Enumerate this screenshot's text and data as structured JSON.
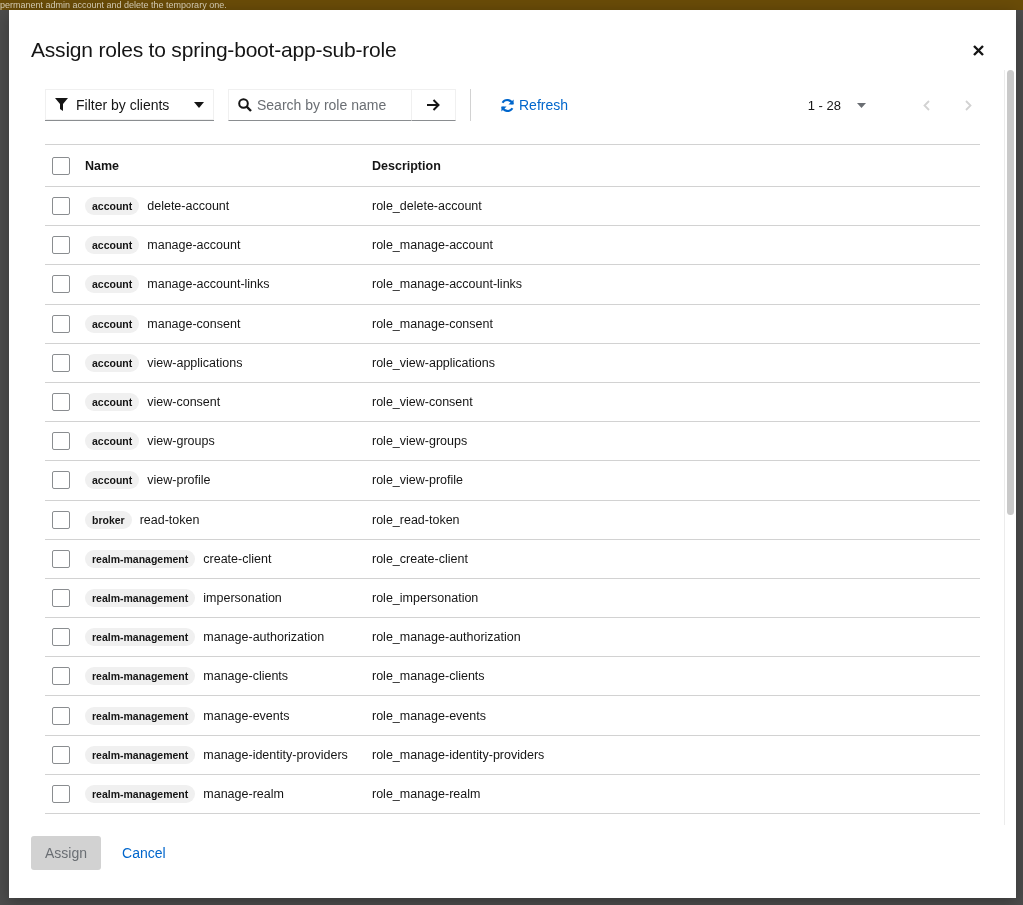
{
  "banner": {
    "text": "permanent admin account and delete the temporary one."
  },
  "modal": {
    "title": "Assign roles to spring-boot-app-sub-role"
  },
  "toolbar": {
    "filter": {
      "label": "Filter by clients"
    },
    "search": {
      "placeholder": "Search by role name"
    },
    "refresh": {
      "label": "Refresh"
    },
    "pagination": {
      "range": "1 - 28",
      "prev_disabled": true,
      "next_disabled": true
    }
  },
  "table": {
    "columns": [
      "Name",
      "Description"
    ],
    "all_checked": false,
    "rows": [
      {
        "client": "account",
        "name": "delete-account",
        "description": "role_delete-account",
        "checked": false
      },
      {
        "client": "account",
        "name": "manage-account",
        "description": "role_manage-account",
        "checked": false
      },
      {
        "client": "account",
        "name": "manage-account-links",
        "description": "role_manage-account-links",
        "checked": false
      },
      {
        "client": "account",
        "name": "manage-consent",
        "description": "role_manage-consent",
        "checked": false
      },
      {
        "client": "account",
        "name": "view-applications",
        "description": "role_view-applications",
        "checked": false
      },
      {
        "client": "account",
        "name": "view-consent",
        "description": "role_view-consent",
        "checked": false
      },
      {
        "client": "account",
        "name": "view-groups",
        "description": "role_view-groups",
        "checked": false
      },
      {
        "client": "account",
        "name": "view-profile",
        "description": "role_view-profile",
        "checked": false
      },
      {
        "client": "broker",
        "name": "read-token",
        "description": "role_read-token",
        "checked": false
      },
      {
        "client": "realm-management",
        "name": "create-client",
        "description": "role_create-client",
        "checked": false
      },
      {
        "client": "realm-management",
        "name": "impersonation",
        "description": "role_impersonation",
        "checked": false
      },
      {
        "client": "realm-management",
        "name": "manage-authorization",
        "description": "role_manage-authorization",
        "checked": false
      },
      {
        "client": "realm-management",
        "name": "manage-clients",
        "description": "role_manage-clients",
        "checked": false
      },
      {
        "client": "realm-management",
        "name": "manage-events",
        "description": "role_manage-events",
        "checked": false
      },
      {
        "client": "realm-management",
        "name": "manage-identity-providers",
        "description": "role_manage-identity-providers",
        "checked": false
      },
      {
        "client": "realm-management",
        "name": "manage-realm",
        "description": "role_manage-realm",
        "checked": false
      }
    ]
  },
  "footer": {
    "assign": {
      "label": "Assign",
      "disabled": true
    },
    "cancel": {
      "label": "Cancel"
    }
  }
}
